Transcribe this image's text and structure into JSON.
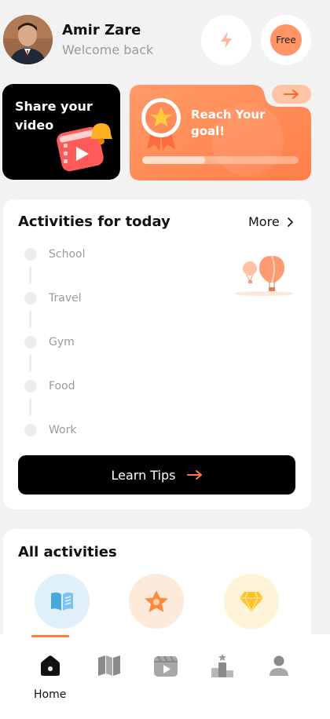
{
  "header": {
    "user_name": "Amir Zare",
    "welcome": "Welcome back",
    "free_badge": "Free"
  },
  "promo": {
    "share_title": "Share your video",
    "goal_title": "Reach Your goal!",
    "goal_progress": 0.4
  },
  "today": {
    "title": "Activities for today",
    "more_label": "More",
    "items": [
      {
        "label": "School"
      },
      {
        "label": "Travel"
      },
      {
        "label": "Gym"
      },
      {
        "label": "Food"
      },
      {
        "label": "Work"
      }
    ],
    "learn_label": "Learn Tips"
  },
  "all_activities": {
    "title": "All activities",
    "icons": [
      "book-icon",
      "star-icon",
      "diamond-icon"
    ]
  },
  "nav": {
    "home_label": "Home",
    "icons": [
      "home-icon",
      "map-icon",
      "video-icon",
      "leaderboard-icon",
      "profile-icon"
    ]
  },
  "colors": {
    "accent": "#ff7a3d",
    "goal_card": "#ff8c5a",
    "background": "#f2f2f2"
  }
}
